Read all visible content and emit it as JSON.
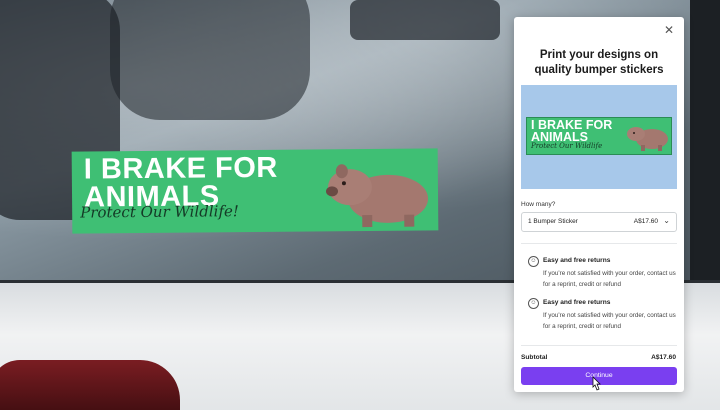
{
  "sticker": {
    "headline": "I BRAKE FOR ANIMALS",
    "tagline": "Protect Our Wildlife!"
  },
  "panel": {
    "title": "Print your designs on quality bumper stickers",
    "close_icon": "close-icon",
    "preview": {
      "headline": "I BRAKE FOR ANIMALS",
      "tagline": "Protect Our Wildlife"
    },
    "quantity": {
      "label": "How many?",
      "selected": "1 Bumper Sticker",
      "price": "A$17.60"
    },
    "features": [
      {
        "icon": "smile-icon",
        "title": "Easy and free returns",
        "description": "If you're not satisfied with your order, contact us for a reprint, credit or refund"
      },
      {
        "icon": "smile-icon",
        "title": "Easy and free returns",
        "description": "If you're not satisfied with your order, contact us for a reprint, credit or refund"
      }
    ],
    "subtotal_label": "Subtotal",
    "subtotal_value": "A$17.60",
    "continue_label": "Continue"
  },
  "colors": {
    "sticker_green": "#3fbf74",
    "preview_bg": "#a7c8ea",
    "button_purple": "#7a3ff0"
  }
}
